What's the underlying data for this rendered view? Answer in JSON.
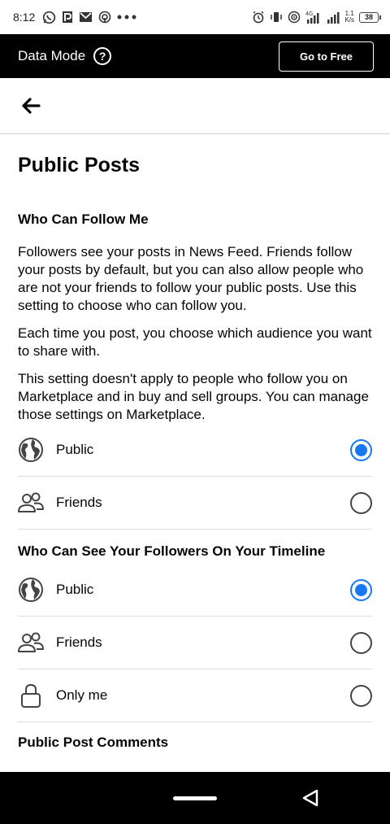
{
  "status_bar": {
    "time": "8:12",
    "net_speed_top": "1.1",
    "net_speed_bottom": "K/s",
    "network": "4G",
    "battery": "38"
  },
  "data_mode": {
    "label": "Data Mode",
    "help_icon": "?",
    "go_free_label": "Go to Free"
  },
  "page": {
    "title": "Public Posts"
  },
  "who_can_follow": {
    "heading": "Who Can Follow Me",
    "paragraphs": [
      "Followers see your posts in News Feed. Friends follow your posts by default, but you can also allow people who are not your friends to follow your public posts. Use this setting to choose who can follow you.",
      "Each time you post, you choose which audience you want to share with.",
      "This setting doesn't apply to people who follow you on Marketplace and in buy and sell groups. You can manage those settings on Marketplace."
    ],
    "options": [
      {
        "label": "Public",
        "icon": "globe-icon",
        "selected": true
      },
      {
        "label": "Friends",
        "icon": "friends-icon",
        "selected": false
      }
    ]
  },
  "followers_visibility": {
    "heading": "Who Can See Your Followers On Your Timeline",
    "options": [
      {
        "label": "Public",
        "icon": "globe-icon",
        "selected": true
      },
      {
        "label": "Friends",
        "icon": "friends-icon",
        "selected": false
      },
      {
        "label": "Only me",
        "icon": "lock-icon",
        "selected": false
      }
    ]
  },
  "comments": {
    "heading": "Public Post Comments"
  },
  "colors": {
    "accent": "#1877f2",
    "bar": "#000000"
  }
}
